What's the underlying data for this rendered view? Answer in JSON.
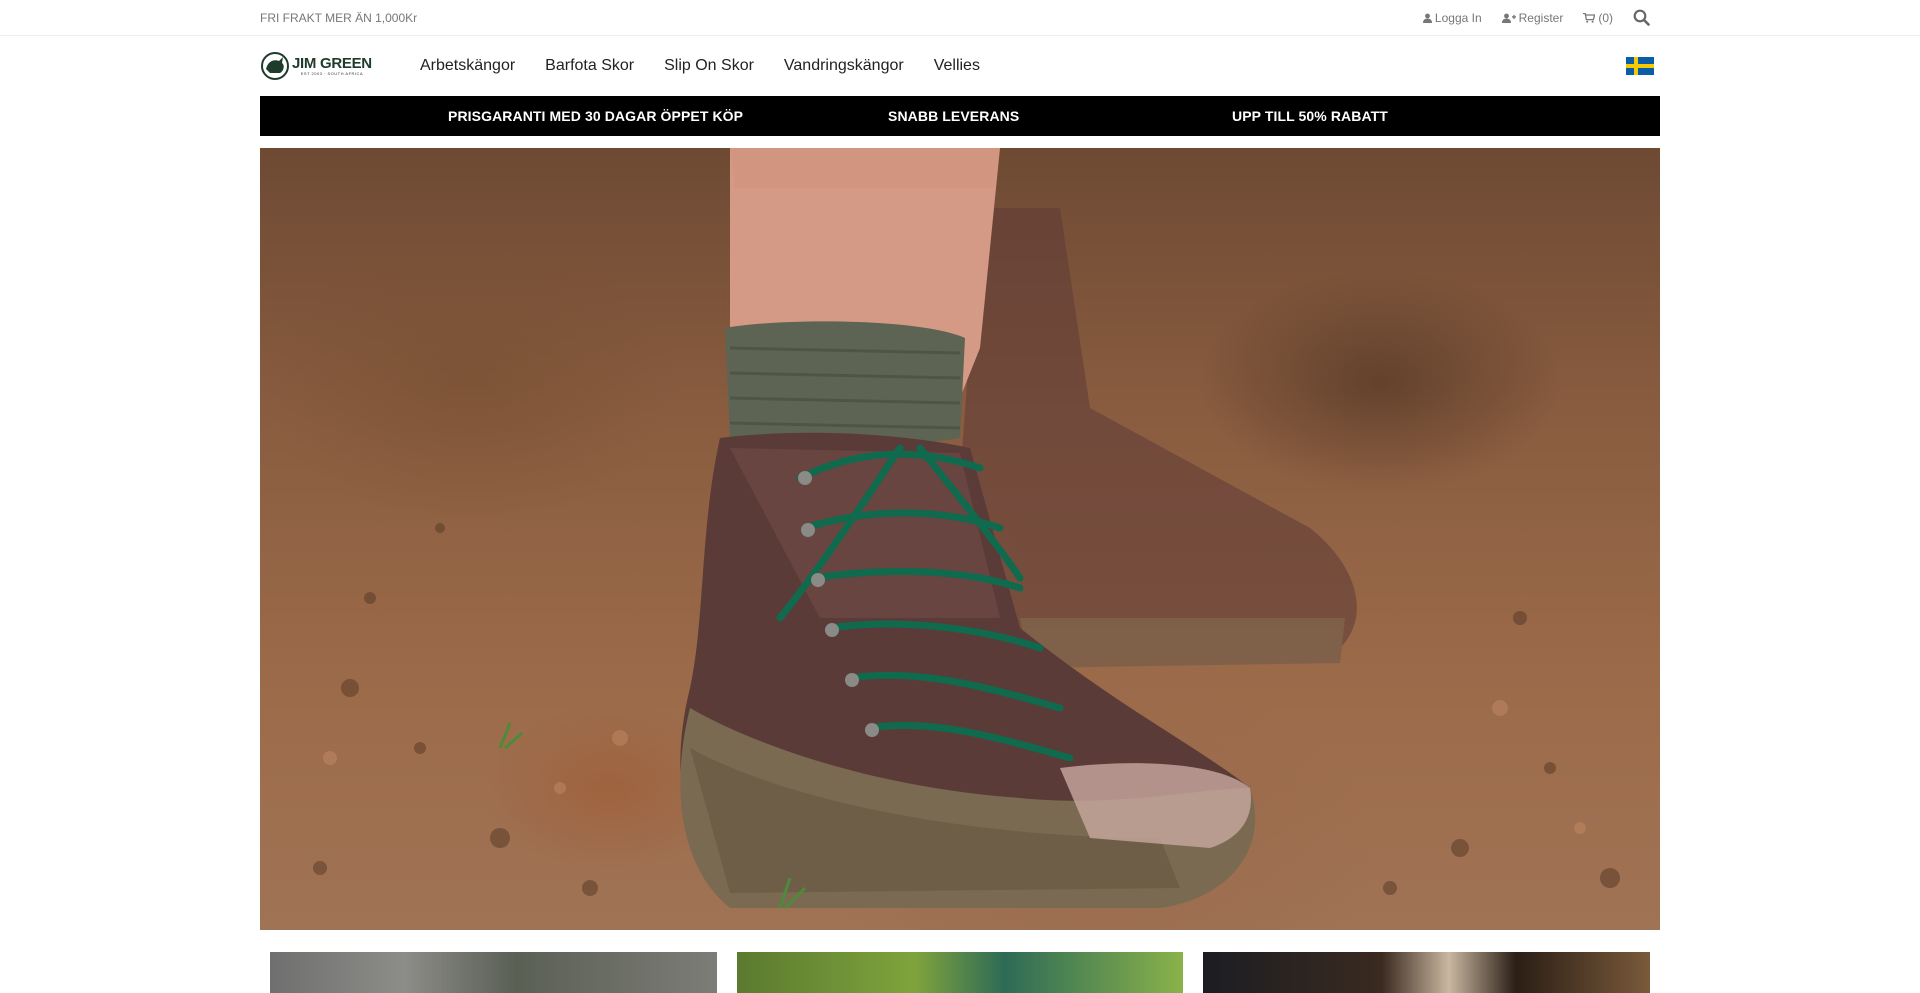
{
  "topbar": {
    "promo": "FRI FRAKT MER ÄN 1,000Kr",
    "login_label": "Logga In",
    "register_label": "Register",
    "cart_label": "(0)",
    "icons": {
      "login": "user-icon",
      "register": "user-plus-icon",
      "cart": "cart-icon",
      "search": "search-icon"
    }
  },
  "header": {
    "logo_text": "JIM GREEN",
    "logo_sub": "EST 2003 · SOUTH AFRICA",
    "nav": [
      {
        "label": "Arbetskängor"
      },
      {
        "label": "Barfota Skor"
      },
      {
        "label": "Slip On Skor"
      },
      {
        "label": "Vandringskängor"
      },
      {
        "label": "Vellies"
      }
    ],
    "locale_flag": "sweden-flag-icon"
  },
  "usp_bar": {
    "items": [
      "PRISGARANTI MED 30 DAGAR ÖPPET KÖP",
      "SNABB LEVERANS",
      "UPP TILL 50% RABATT"
    ]
  },
  "hero": {
    "image": "hiking-boot-in-mud-photo"
  },
  "category_cards": [
    {
      "image": "work-boots-photo"
    },
    {
      "image": "boots-in-grass-photo"
    },
    {
      "image": "vellies-photo"
    }
  ],
  "colors": {
    "usp_background": "#000000",
    "usp_text": "#ffffff",
    "lace_green": "#0f6a4e"
  }
}
